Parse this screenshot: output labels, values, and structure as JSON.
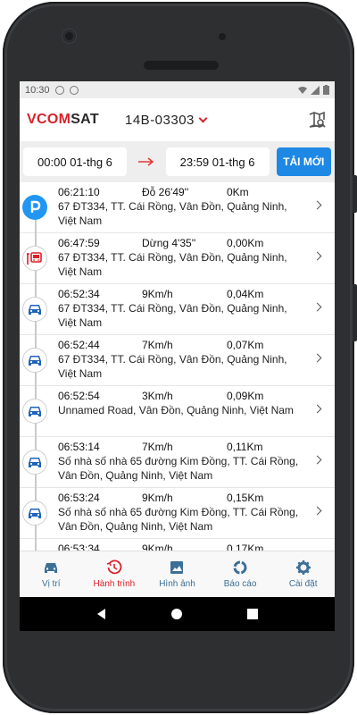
{
  "status_bar": {
    "time": "10:30"
  },
  "header": {
    "logo_part1": "VCOM",
    "logo_part2": "SAT",
    "plate": "14B-03303"
  },
  "time_range": {
    "from": "00:00 01-thg 6",
    "to": "23:59 01-thg 6",
    "reload_label": "TẢI MỚI"
  },
  "trips": [
    {
      "icon": "parking-icon",
      "time": "06:21:10",
      "status": "Đỗ 26'49''",
      "distance": "0Km",
      "address": "67 ĐT334, TT. Cái Rồng, Vân Đồn, Quảng Ninh, Việt Nam"
    },
    {
      "icon": "bus-stop-icon",
      "time": "06:47:59",
      "status": "Dừng 4'35''",
      "distance": "0,00Km",
      "address": "67 ĐT334, TT. Cái Rồng, Vân Đồn, Quảng Ninh, Việt Nam"
    },
    {
      "icon": "car-icon",
      "time": "06:52:34",
      "status": "9Km/h",
      "distance": "0,04Km",
      "address": "67 ĐT334, TT. Cái Rồng, Vân Đồn, Quảng Ninh, Việt Nam"
    },
    {
      "icon": "car-icon",
      "time": "06:52:44",
      "status": "7Km/h",
      "distance": "0,07Km",
      "address": "67 ĐT334, TT. Cái Rồng, Vân Đồn, Quảng Ninh, Việt Nam"
    },
    {
      "icon": "car-icon",
      "time": "06:52:54",
      "status": "3Km/h",
      "distance": "0,09Km",
      "address": "Unnamed Road, Vân Đồn, Quảng Ninh, Việt Nam"
    },
    {
      "icon": "car-icon",
      "time": "06:53:14",
      "status": "7Km/h",
      "distance": "0,11Km",
      "address": "Số nhà số nhà 65 đường Kim Đồng, TT. Cái Rồng, Vân Đồn, Quảng Ninh, Việt Nam"
    },
    {
      "icon": "car-icon",
      "time": "06:53:24",
      "status": "9Km/h",
      "distance": "0,15Km",
      "address": "Số nhà số nhà 65 đường Kim Đồng, TT. Cái Rồng, Vân Đồn, Quảng Ninh, Việt Nam"
    },
    {
      "icon": "car-icon",
      "time": "06:53:34",
      "status": "9Km/h",
      "distance": "0,17Km",
      "address": ""
    }
  ],
  "nav": [
    {
      "label": "Vị trí",
      "icon": "car-icon",
      "active": false
    },
    {
      "label": "Hành trình",
      "icon": "history-icon",
      "active": true
    },
    {
      "label": "Hình ảnh",
      "icon": "image-icon",
      "active": false
    },
    {
      "label": "Báo cáo",
      "icon": "report-icon",
      "active": false
    },
    {
      "label": "Cài đặt",
      "icon": "gear-icon",
      "active": false
    }
  ],
  "colors": {
    "brand_red": "#d9222a",
    "accent_blue": "#1e88e5",
    "nav_blue": "#3b6f96"
  }
}
